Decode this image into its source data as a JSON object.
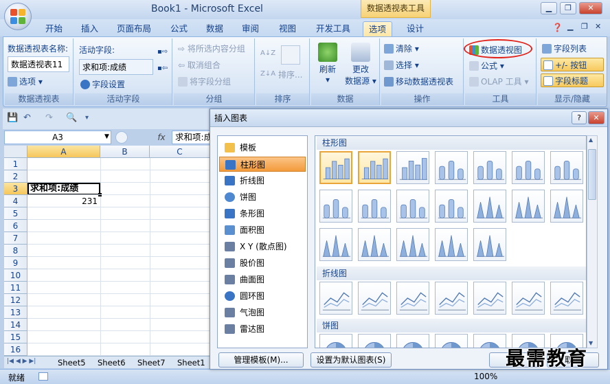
{
  "window": {
    "title": "Book1 - Microsoft Excel",
    "tools_tab": "数据透视表工具"
  },
  "tabs": [
    {
      "label": "开始"
    },
    {
      "label": "插入"
    },
    {
      "label": "页面布局"
    },
    {
      "label": "公式"
    },
    {
      "label": "数据"
    },
    {
      "label": "审阅"
    },
    {
      "label": "视图"
    },
    {
      "label": "开发工具"
    },
    {
      "label": "选项"
    },
    {
      "label": "设计"
    }
  ],
  "ribbon": {
    "pivot": {
      "name_label": "数据透视表名称:",
      "name_value": "数据透视表11",
      "options": "选项",
      "group": "数据透视表"
    },
    "active_field": {
      "label": "活动字段:",
      "value": "求和项:成绩",
      "settings": "字段设置",
      "group": "活动字段"
    },
    "grouping": {
      "group_sel": "将所选内容分组",
      "ungroup": "取消组合",
      "group_field": "将字段分组",
      "group": "分组"
    },
    "sort": {
      "sort": "排序...",
      "group": "排序"
    },
    "data": {
      "refresh": "刷新",
      "change_source": "更改",
      "change_source2": "数据源",
      "group": "数据"
    },
    "actions": {
      "clear": "清除",
      "select": "选择",
      "move": "移动数据透视表",
      "group": "操作"
    },
    "tools": {
      "pivot_chart": "数据透视图",
      "formulas": "公式",
      "olap": "OLAP 工具",
      "group": "工具"
    },
    "show_hide": {
      "field_list": "字段列表",
      "buttons": "+/- 按钮",
      "headers": "字段标题",
      "group": "显示/隐藏"
    }
  },
  "formula_bar": {
    "name_box": "A3",
    "fx": "fx",
    "formula": "求和项:成绩"
  },
  "sheet": {
    "columns": [
      "A",
      "B",
      "C"
    ],
    "rows": [
      "1",
      "2",
      "3",
      "4",
      "5",
      "6",
      "7",
      "8",
      "9",
      "10",
      "11",
      "12",
      "13",
      "14",
      "15",
      "16"
    ],
    "a3": "求和项:成绩",
    "a4": "231",
    "tabs": [
      "Sheet5",
      "Sheet6",
      "Sheet7",
      "Sheet1"
    ]
  },
  "status": {
    "ready": "就绪",
    "zoom": "100%"
  },
  "dialog": {
    "title": "插入图表",
    "categories": [
      {
        "label": "模板"
      },
      {
        "label": "柱形图"
      },
      {
        "label": "折线图"
      },
      {
        "label": "饼图"
      },
      {
        "label": "条形图"
      },
      {
        "label": "面积图"
      },
      {
        "label": "X Y (散点图)"
      },
      {
        "label": "股价图"
      },
      {
        "label": "曲面图"
      },
      {
        "label": "圆环图"
      },
      {
        "label": "气泡图"
      },
      {
        "label": "雷达图"
      }
    ],
    "sections": {
      "column": "柱形图",
      "line": "折线图",
      "pie": "饼图"
    },
    "manage_templates": "管理模板(M)...",
    "set_default": "设置为默认图表(S)",
    "ok": "确定",
    "cancel": "取消"
  },
  "watermark": "最需教育",
  "colors": {
    "accent": "#15428b",
    "selected": "#f39b3b",
    "highlight_ellipse": "#e2231a"
  }
}
